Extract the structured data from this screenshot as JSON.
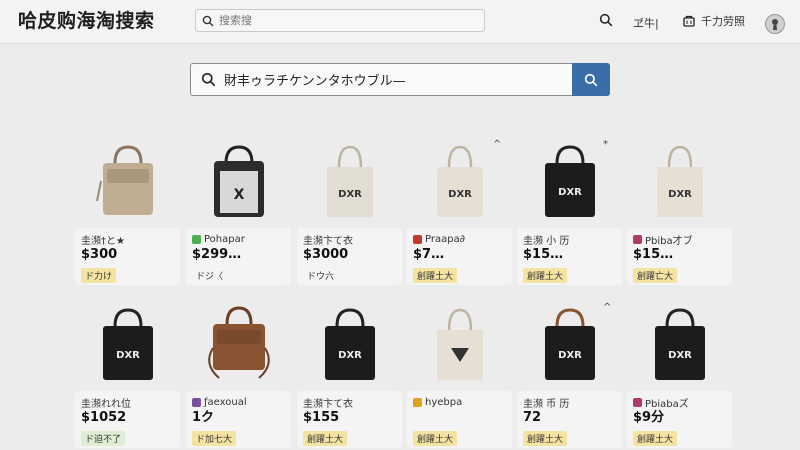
{
  "header": {
    "logo": "哈皮购海淘搜索",
    "search_placeholder": "搜索搜",
    "messages_label": "ヹ牛|",
    "cart_label": "千力劳照"
  },
  "search": {
    "query": "財丰ゥラチケンンタホウブル—"
  },
  "products": [
    {
      "name": "圭瀕†と★",
      "price": "$300",
      "badge": "ド力け",
      "store_color": "",
      "badge_style": "yellow"
    },
    {
      "name": "Pohapar",
      "price": "$299…",
      "badge": "ドジ〈",
      "store_color": "#4caf50",
      "badge_style": "plain"
    },
    {
      "name": "圭瀕卞て衣",
      "price": "$3000",
      "badge": "ドウ六",
      "store_color": "",
      "badge_style": "plain"
    },
    {
      "name": "Praapa∂",
      "price": "$7…",
      "badge": "創躍土大",
      "store_color": "#c0392b",
      "badge_style": "yellow"
    },
    {
      "name": "圭瀕 小 历",
      "price": "$15…",
      "badge": "創躍土大",
      "store_color": "",
      "badge_style": "yellow"
    },
    {
      "name": "Pbiba才ブ",
      "price": "$15…",
      "badge": "創躍亡大",
      "store_color": "#b03a6a",
      "badge_style": "yellow"
    },
    {
      "name": "圭瀕れれ位",
      "price": "$1052",
      "badge": "ド迫不了",
      "store_color": "",
      "badge_style": "green"
    },
    {
      "name": "ƒaexoual",
      "price": "1ク",
      "badge": "ド加七大",
      "store_color": "#7b4fa0",
      "badge_style": "yellow"
    },
    {
      "name": "圭瀕卞て衣",
      "price": "$155",
      "badge": "創躍土大",
      "store_color": "",
      "badge_style": "yellow"
    },
    {
      "name": "hyebpa",
      "price": "",
      "badge": "創躍土大",
      "store_color": "#e0a020",
      "badge_style": "yellow"
    },
    {
      "name": "圭瀕 币 历",
      "price": "72",
      "badge": "創躍土大",
      "store_color": "",
      "badge_style": "yellow"
    },
    {
      "name": "Pbiabaズ",
      "price": "$9分",
      "badge": "創躍土大",
      "store_color": "#b03a6a",
      "badge_style": "yellow"
    }
  ],
  "icons": {
    "search": "search-icon",
    "cart": "cart-icon",
    "avatar": "user-avatar-icon"
  },
  "colors": {
    "accent": "#3b6ea8",
    "badge_yellow": "#f4e3a1",
    "badge_green": "#dfeed3"
  }
}
